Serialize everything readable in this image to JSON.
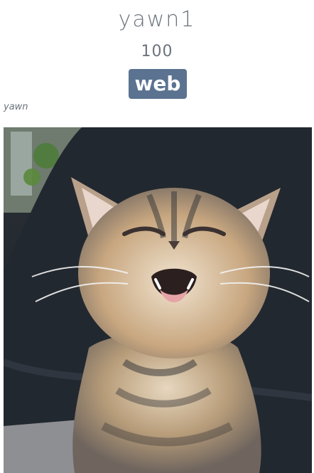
{
  "card": {
    "title": "yawn1",
    "count": "100",
    "badge_label": "web",
    "caption": "yawn"
  },
  "photo": {
    "subject": "yawning tabby kitten",
    "icon": "kitten-photo"
  },
  "colors": {
    "badge_bg": "#5b7390",
    "text": "#6b737c"
  }
}
